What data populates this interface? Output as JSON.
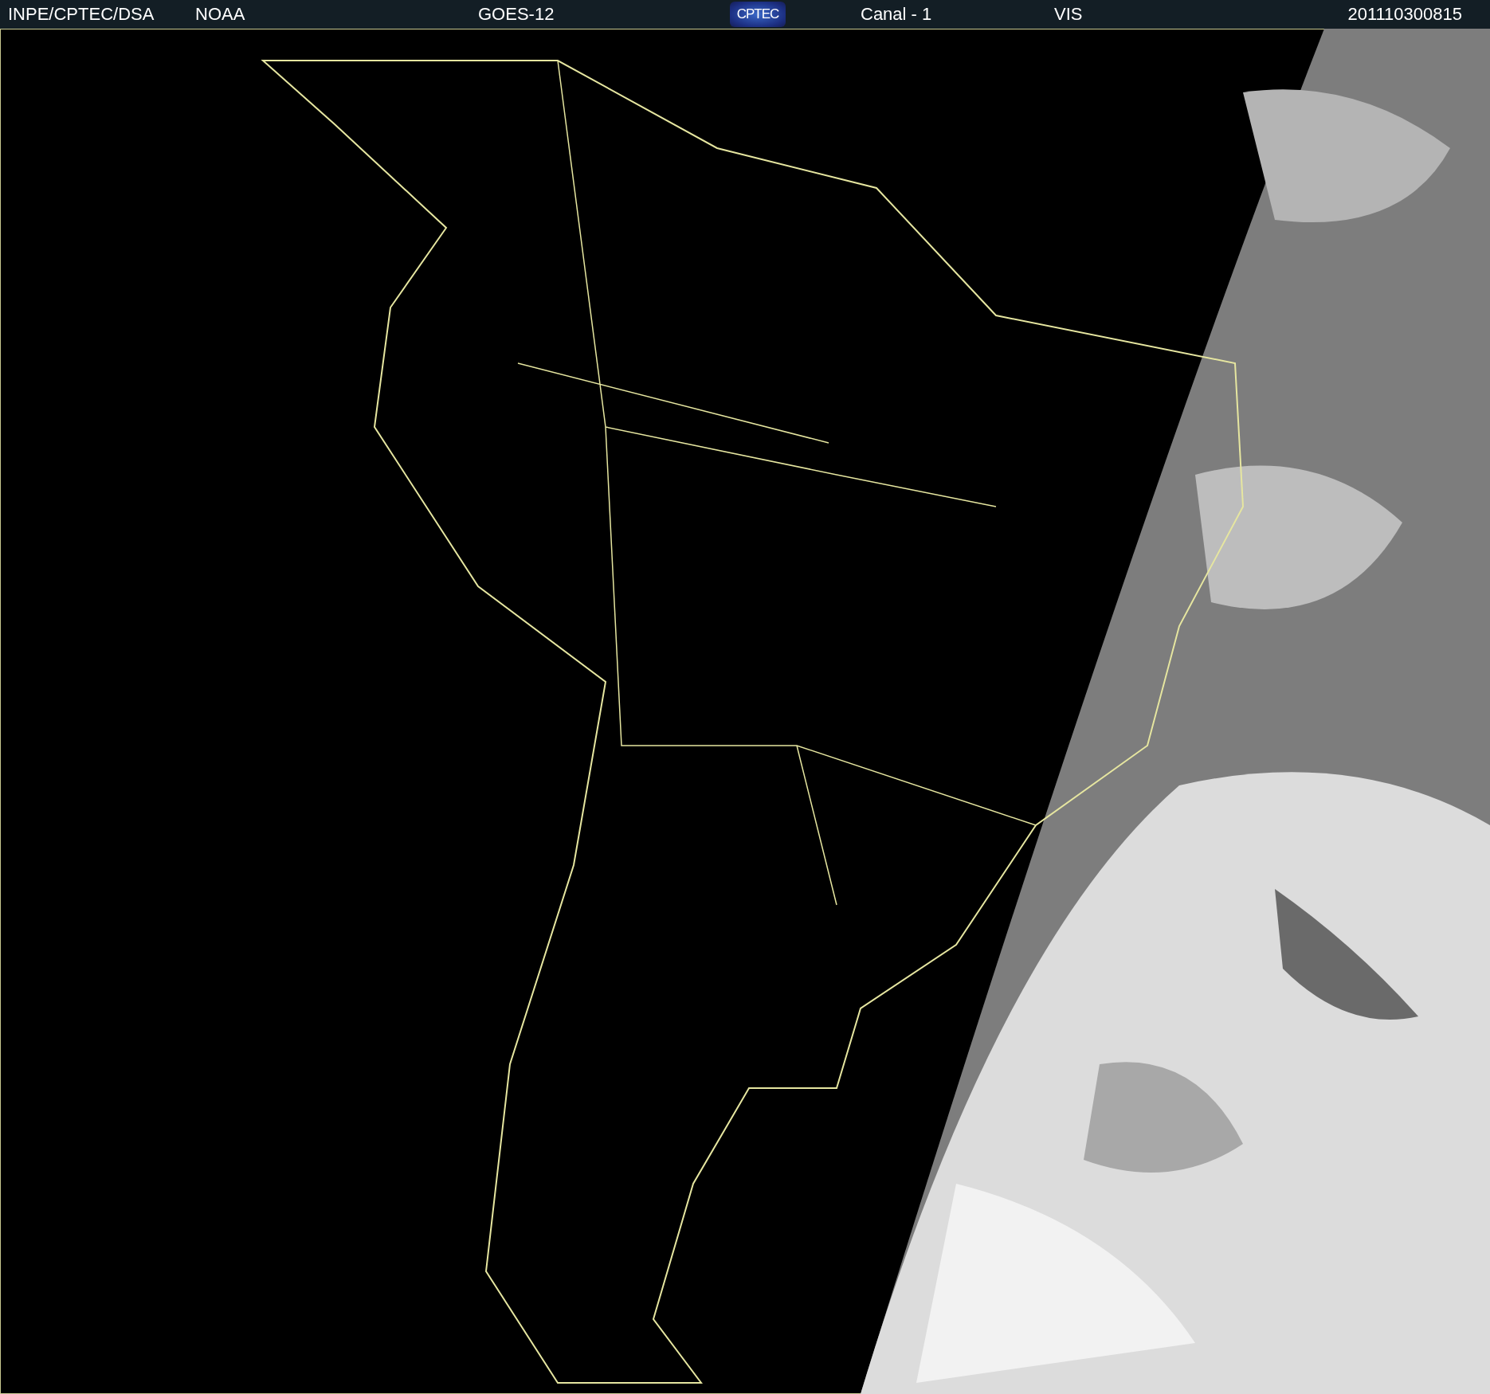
{
  "header": {
    "items": [
      {
        "kind": "text",
        "text": "INPE/CPTEC/DSA"
      },
      {
        "kind": "text",
        "text": "NOAA"
      },
      {
        "kind": "text",
        "text": "GOES-12"
      },
      {
        "kind": "logo",
        "text": "CPTEC"
      },
      {
        "kind": "text",
        "text": "Canal - 1"
      },
      {
        "kind": "text",
        "text": "VIS"
      },
      {
        "kind": "text",
        "text": "201110300815"
      }
    ]
  }
}
